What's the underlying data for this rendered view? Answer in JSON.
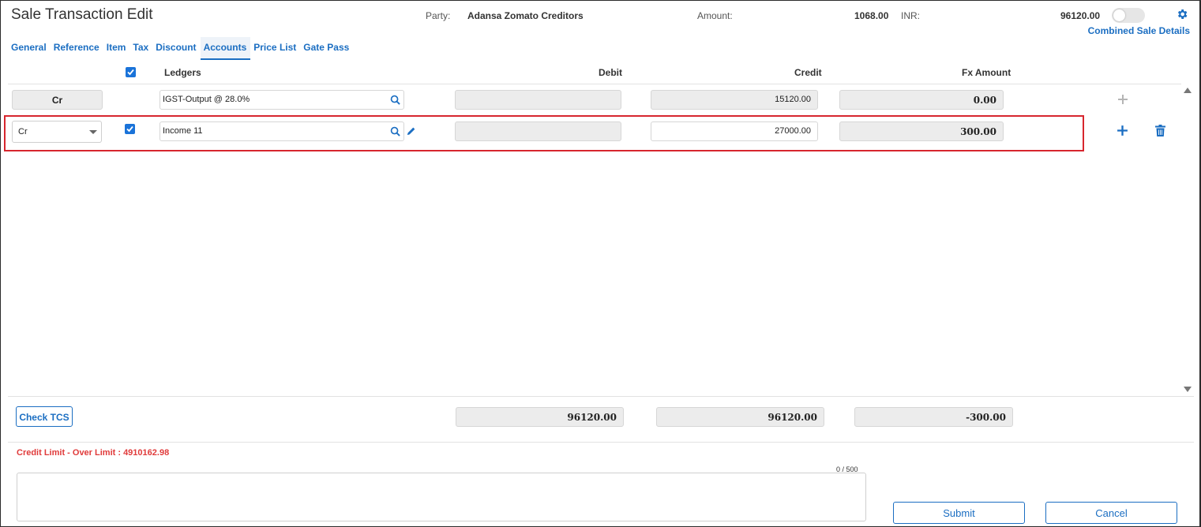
{
  "header": {
    "title": "Sale Transaction Edit",
    "party_label": "Party:",
    "party_value": "Adansa Zomato Creditors",
    "amount_label": "Amount:",
    "amount_value": "1068.00",
    "currency_label": "INR:",
    "currency_value": "96120.00",
    "combined_link": "Combined Sale Details",
    "gear_icon": "gear-icon",
    "toggle_on": false
  },
  "tabs": [
    {
      "label": "General",
      "active": false
    },
    {
      "label": "Reference",
      "active": false
    },
    {
      "label": "Item",
      "active": false
    },
    {
      "label": "Tax",
      "active": false
    },
    {
      "label": "Discount",
      "active": false
    },
    {
      "label": "Accounts",
      "active": true
    },
    {
      "label": "Price List",
      "active": false
    },
    {
      "label": "Gate Pass",
      "active": false
    }
  ],
  "columns": {
    "select_all_checked": true,
    "ledgers": "Ledgers",
    "debit": "Debit",
    "credit": "Credit",
    "fx_amount": "Fx Amount"
  },
  "rows": [
    {
      "type": "Cr",
      "checked": false,
      "ledger": "IGST-Output @ 28.0%",
      "debit": "",
      "credit": "15120.00",
      "fx_amount": "0.00",
      "editable": false
    },
    {
      "type": "Cr",
      "checked": true,
      "ledger": "Income 11",
      "debit": "",
      "credit": "27000.00",
      "fx_amount": "300.00",
      "editable": true,
      "highlighted": true
    }
  ],
  "footer": {
    "check_tcs_label": "Check TCS",
    "total_debit": "96120.00",
    "total_credit": "96120.00",
    "total_fx": "-300.00",
    "credit_limit_text": "Credit Limit - Over Limit : 4910162.98",
    "notes_counter": "0 / 500",
    "notes_value": "",
    "submit_label": "Submit",
    "cancel_label": "Cancel"
  },
  "colors": {
    "accent": "#1b6ec2",
    "highlight_border": "#d7262e",
    "warning_text": "#e03a3a"
  }
}
